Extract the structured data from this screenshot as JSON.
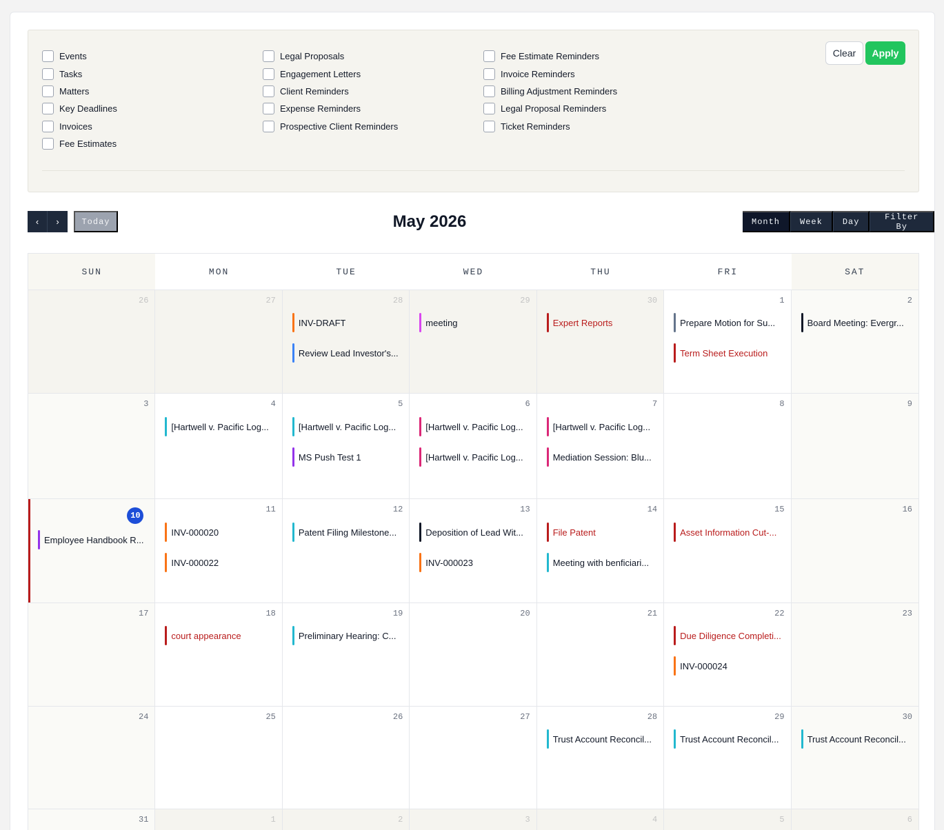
{
  "filters": {
    "columns": [
      [
        "Events",
        "Tasks",
        "Matters",
        "Key Deadlines",
        "Invoices",
        "Fee Estimates"
      ],
      [
        "Legal Proposals",
        "Engagement Letters",
        "Client Reminders",
        "Expense Reminders",
        "Prospective Client Reminders"
      ],
      [
        "Fee Estimate Reminders",
        "Invoice Reminders",
        "Billing Adjustment Reminders",
        "Legal Proposal Reminders",
        "Ticket Reminders"
      ]
    ],
    "clear_label": "Clear",
    "apply_label": "Apply"
  },
  "toolbar": {
    "prev_icon": "‹",
    "next_icon": "›",
    "today_label": "Today",
    "title": "May 2026",
    "views": [
      "Month",
      "Week",
      "Day",
      "Filter By"
    ],
    "active_view": "Month"
  },
  "colors": {
    "orange": "#f97316",
    "blue": "#3b82f6",
    "pink": "#d946ef",
    "red": "#b91c1c",
    "gray": "#64748b",
    "black": "#111827",
    "cyan": "#22b8cf",
    "crimson": "#db2777",
    "purple": "#9333ea",
    "today_badge": "#1d4ed8",
    "apply_green": "#22c55e"
  },
  "calendar": {
    "weekdays": [
      "SUN",
      "MON",
      "TUE",
      "WED",
      "THU",
      "FRI",
      "SAT"
    ],
    "weeks": [
      [
        {
          "day": "26",
          "other": true,
          "events": []
        },
        {
          "day": "27",
          "other": true,
          "events": []
        },
        {
          "day": "28",
          "other": true,
          "events": [
            {
              "title": "INV-DRAFT",
              "color": "orange"
            },
            {
              "title": "Review Lead Investor's...",
              "color": "blue"
            }
          ]
        },
        {
          "day": "29",
          "other": true,
          "events": [
            {
              "title": "meeting",
              "color": "pink"
            }
          ]
        },
        {
          "day": "30",
          "other": true,
          "events": [
            {
              "title": "Expert Reports",
              "color": "red",
              "text_red": true
            }
          ]
        },
        {
          "day": "1",
          "events": [
            {
              "title": "Prepare Motion for Su...",
              "color": "gray"
            },
            {
              "title": "Term Sheet Execution",
              "color": "red",
              "text_red": true
            }
          ]
        },
        {
          "day": "2",
          "events": [
            {
              "title": "Board Meeting: Evergr...",
              "color": "black"
            }
          ]
        }
      ],
      [
        {
          "day": "3",
          "events": []
        },
        {
          "day": "4",
          "events": [
            {
              "title": "[Hartwell v. Pacific Log...",
              "color": "cyan"
            }
          ]
        },
        {
          "day": "5",
          "events": [
            {
              "title": "[Hartwell v. Pacific Log...",
              "color": "cyan"
            },
            {
              "title": "MS Push Test 1",
              "color": "purple"
            }
          ]
        },
        {
          "day": "6",
          "events": [
            {
              "title": "[Hartwell v. Pacific Log...",
              "color": "crimson"
            },
            {
              "title": "[Hartwell v. Pacific Log...",
              "color": "crimson"
            }
          ]
        },
        {
          "day": "7",
          "events": [
            {
              "title": "[Hartwell v. Pacific Log...",
              "color": "crimson"
            },
            {
              "title": "Mediation Session: Blu...",
              "color": "crimson"
            }
          ]
        },
        {
          "day": "8",
          "events": []
        },
        {
          "day": "9",
          "events": []
        }
      ],
      [
        {
          "day": "10",
          "today": true,
          "events": [
            {
              "title": "Employee Handbook R...",
              "color": "purple"
            }
          ]
        },
        {
          "day": "11",
          "events": [
            {
              "title": "INV-000020",
              "color": "orange"
            },
            {
              "title": "INV-000022",
              "color": "orange"
            }
          ]
        },
        {
          "day": "12",
          "events": [
            {
              "title": "Patent Filing Milestone...",
              "color": "cyan"
            }
          ]
        },
        {
          "day": "13",
          "events": [
            {
              "title": "Deposition of Lead Wit...",
              "color": "black"
            },
            {
              "title": "INV-000023",
              "color": "orange"
            }
          ]
        },
        {
          "day": "14",
          "events": [
            {
              "title": "File Patent",
              "color": "red",
              "text_red": true
            },
            {
              "title": "Meeting with benficiari...",
              "color": "cyan"
            }
          ]
        },
        {
          "day": "15",
          "events": [
            {
              "title": "Asset Information Cut-...",
              "color": "red",
              "text_red": true
            }
          ]
        },
        {
          "day": "16",
          "events": []
        }
      ],
      [
        {
          "day": "17",
          "events": []
        },
        {
          "day": "18",
          "events": [
            {
              "title": "court appearance",
              "color": "red",
              "text_red": true
            }
          ]
        },
        {
          "day": "19",
          "events": [
            {
              "title": "Preliminary Hearing: C...",
              "color": "cyan"
            }
          ]
        },
        {
          "day": "20",
          "events": []
        },
        {
          "day": "21",
          "events": []
        },
        {
          "day": "22",
          "events": [
            {
              "title": "Due Diligence Completi...",
              "color": "red",
              "text_red": true
            },
            {
              "title": "INV-000024",
              "color": "orange"
            }
          ]
        },
        {
          "day": "23",
          "events": []
        }
      ],
      [
        {
          "day": "24",
          "events": []
        },
        {
          "day": "25",
          "events": []
        },
        {
          "day": "26",
          "events": []
        },
        {
          "day": "27",
          "events": []
        },
        {
          "day": "28",
          "events": [
            {
              "title": "Trust Account Reconcil...",
              "color": "cyan"
            }
          ]
        },
        {
          "day": "29",
          "events": [
            {
              "title": "Trust Account Reconcil...",
              "color": "cyan"
            }
          ]
        },
        {
          "day": "30",
          "events": [
            {
              "title": "Trust Account Reconcil...",
              "color": "cyan"
            }
          ]
        }
      ],
      [
        {
          "day": "31",
          "events": []
        },
        {
          "day": "1",
          "other": true,
          "events": []
        },
        {
          "day": "2",
          "other": true,
          "events": []
        },
        {
          "day": "3",
          "other": true,
          "events": []
        },
        {
          "day": "4",
          "other": true,
          "events": []
        },
        {
          "day": "5",
          "other": true,
          "events": []
        },
        {
          "day": "6",
          "other": true,
          "events": []
        }
      ]
    ]
  }
}
